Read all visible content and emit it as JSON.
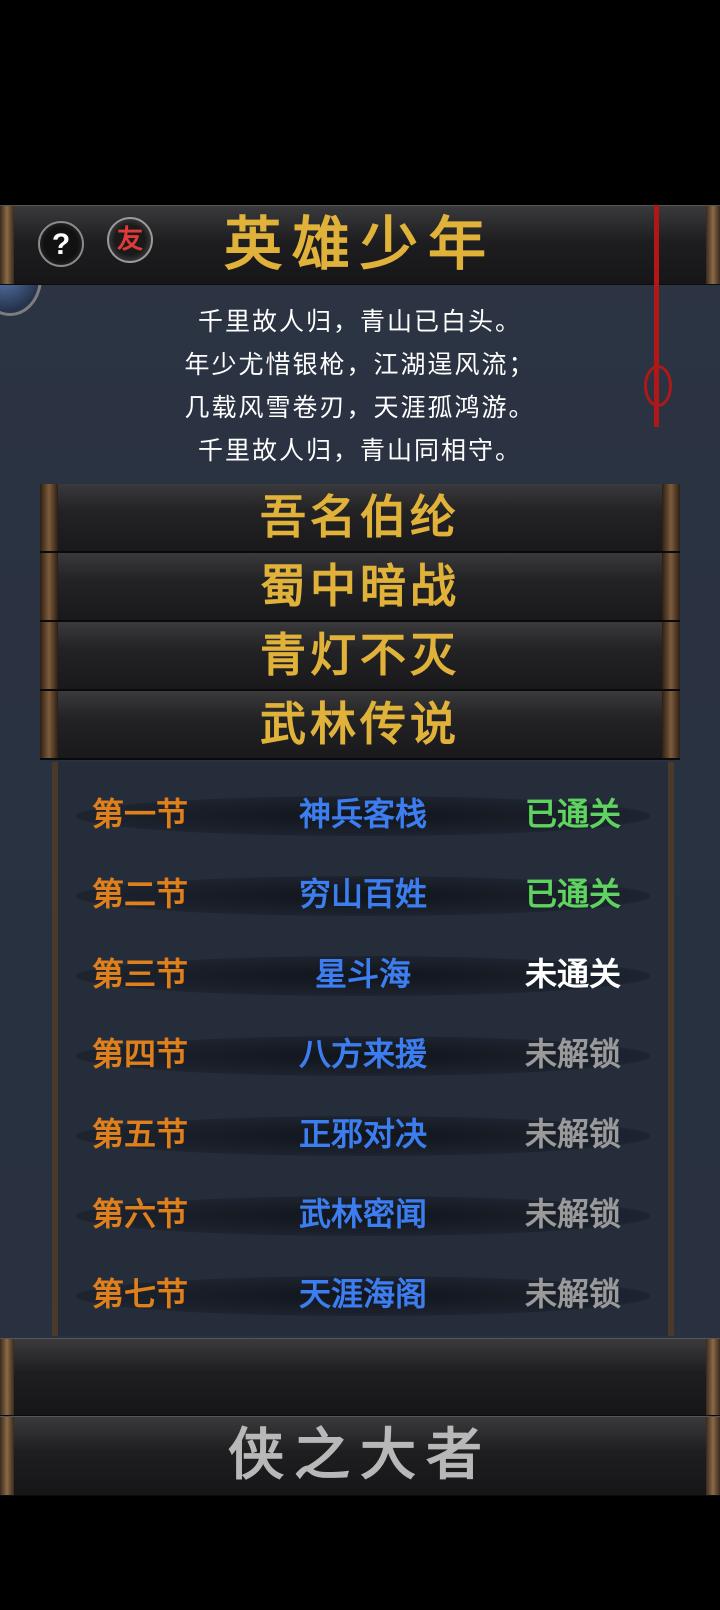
{
  "header": {
    "title": "英雄少年",
    "help_icon": "question-mark-icon",
    "friend_badge": "友"
  },
  "poem": {
    "lines": [
      "千里故人归，青山已白头。",
      "年少尤惜银枪，江湖逞风流；",
      "几载风雪卷刃，天涯孤鸿游。",
      "千里故人归，青山同相守。"
    ]
  },
  "chapters": [
    {
      "label": "吾名伯纶"
    },
    {
      "label": "蜀中暗战"
    },
    {
      "label": "青灯不灭"
    },
    {
      "label": "武林传说"
    }
  ],
  "sections": [
    {
      "number": "第一节",
      "name": "神兵客栈",
      "status": "已通关",
      "state": "cleared"
    },
    {
      "number": "第二节",
      "name": "穷山百姓",
      "status": "已通关",
      "state": "cleared"
    },
    {
      "number": "第三节",
      "name": "星斗海",
      "status": "未通关",
      "state": "open"
    },
    {
      "number": "第四节",
      "name": "八方来援",
      "status": "未解锁",
      "state": "locked"
    },
    {
      "number": "第五节",
      "name": "正邪对决",
      "status": "未解锁",
      "state": "locked"
    },
    {
      "number": "第六节",
      "name": "武林密闻",
      "status": "未解锁",
      "state": "locked"
    },
    {
      "number": "第七节",
      "name": "天涯海阁",
      "status": "未解锁",
      "state": "locked"
    }
  ],
  "footer": {
    "title": "侠之大者"
  },
  "colors": {
    "gold": "#e0b23a",
    "section_number": "#e0801c",
    "section_name": "#3c7df0",
    "cleared": "#5fd35f",
    "open": "#ffffff",
    "locked": "#9a9a9a"
  }
}
